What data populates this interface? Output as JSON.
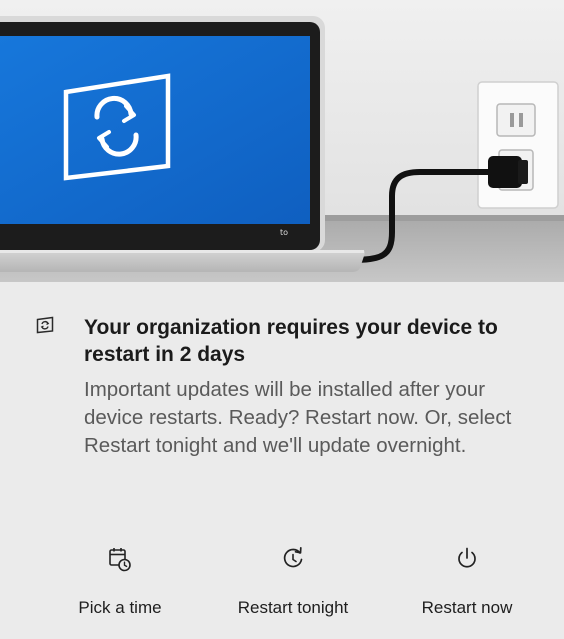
{
  "hero": {
    "illustration": "laptop-plugged-into-wall-outlet",
    "screen_color": "#1a6fd1",
    "laptop_badge": "to"
  },
  "notification": {
    "app_icon": "windows-update-icon",
    "title": "Your organization requires your device to restart in 2 days",
    "message": "Important updates will be installed after your device restarts. Ready? Restart now. Or, select Restart tonight and we'll update overnight."
  },
  "actions": {
    "pick_time": {
      "label": "Pick a time",
      "icon": "calendar-clock-icon"
    },
    "restart_tonight": {
      "label": "Restart tonight",
      "icon": "clock-refresh-icon"
    },
    "restart_now": {
      "label": "Restart now",
      "icon": "power-icon"
    }
  },
  "colors": {
    "background": "#ebebeb",
    "title_text": "#1b1b1b",
    "message_text": "#5a5a5a",
    "accent_blue": "#1a6fd1"
  }
}
